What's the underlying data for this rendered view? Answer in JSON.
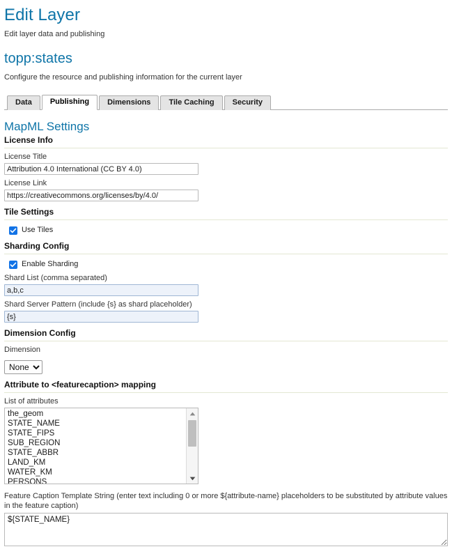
{
  "header": {
    "title": "Edit Layer",
    "subtitle": "Edit layer data and publishing",
    "resource_title": "topp:states",
    "resource_subtitle": "Configure the resource and publishing information for the current layer"
  },
  "tabs": [
    {
      "label": "Data",
      "active": false
    },
    {
      "label": "Publishing",
      "active": true
    },
    {
      "label": "Dimensions",
      "active": false
    },
    {
      "label": "Tile Caching",
      "active": false
    },
    {
      "label": "Security",
      "active": false
    }
  ],
  "mapml": {
    "heading": "MapML Settings",
    "license": {
      "heading": "License Info",
      "title_label": "License Title",
      "title_value": "Attribution 4.0 International (CC BY 4.0)",
      "link_label": "License Link",
      "link_value": "https://creativecommons.org/licenses/by/4.0/"
    },
    "tile_settings": {
      "heading": "Tile Settings",
      "use_tiles_label": "Use Tiles",
      "use_tiles_checked": true
    },
    "sharding": {
      "heading": "Sharding Config",
      "enable_label": "Enable Sharding",
      "enable_checked": true,
      "shard_list_label": "Shard List (comma separated)",
      "shard_list_value": "a,b,c",
      "shard_pattern_label": "Shard Server Pattern (include {s} as shard placeholder)",
      "shard_pattern_value": "{s}"
    },
    "dimension": {
      "heading": "Dimension Config",
      "label": "Dimension",
      "selected": "None",
      "options": [
        "None"
      ]
    },
    "featurecaption": {
      "heading": "Attribute to <featurecaption> mapping",
      "list_label": "List of attributes",
      "attributes": [
        "the_geom",
        "STATE_NAME",
        "STATE_FIPS",
        "SUB_REGION",
        "STATE_ABBR",
        "LAND_KM",
        "WATER_KM",
        "PERSONS"
      ],
      "caption_label": "Feature Caption Template String (enter text including 0 or more ${attribute-name} placeholders to be substituted by attribute values in the feature caption)",
      "caption_value": "${STATE_NAME}"
    }
  },
  "colors": {
    "accent": "#0f75a8",
    "checkbox": "#1273e6",
    "divider": "#e3e7d3",
    "tinted_input": "#edf2fa"
  },
  "icons": {
    "checkmark": "check-icon",
    "scroll_up": "scroll-up-arrow-icon",
    "scroll_down": "scroll-down-arrow-icon",
    "dropdown": "chevron-down-icon"
  }
}
